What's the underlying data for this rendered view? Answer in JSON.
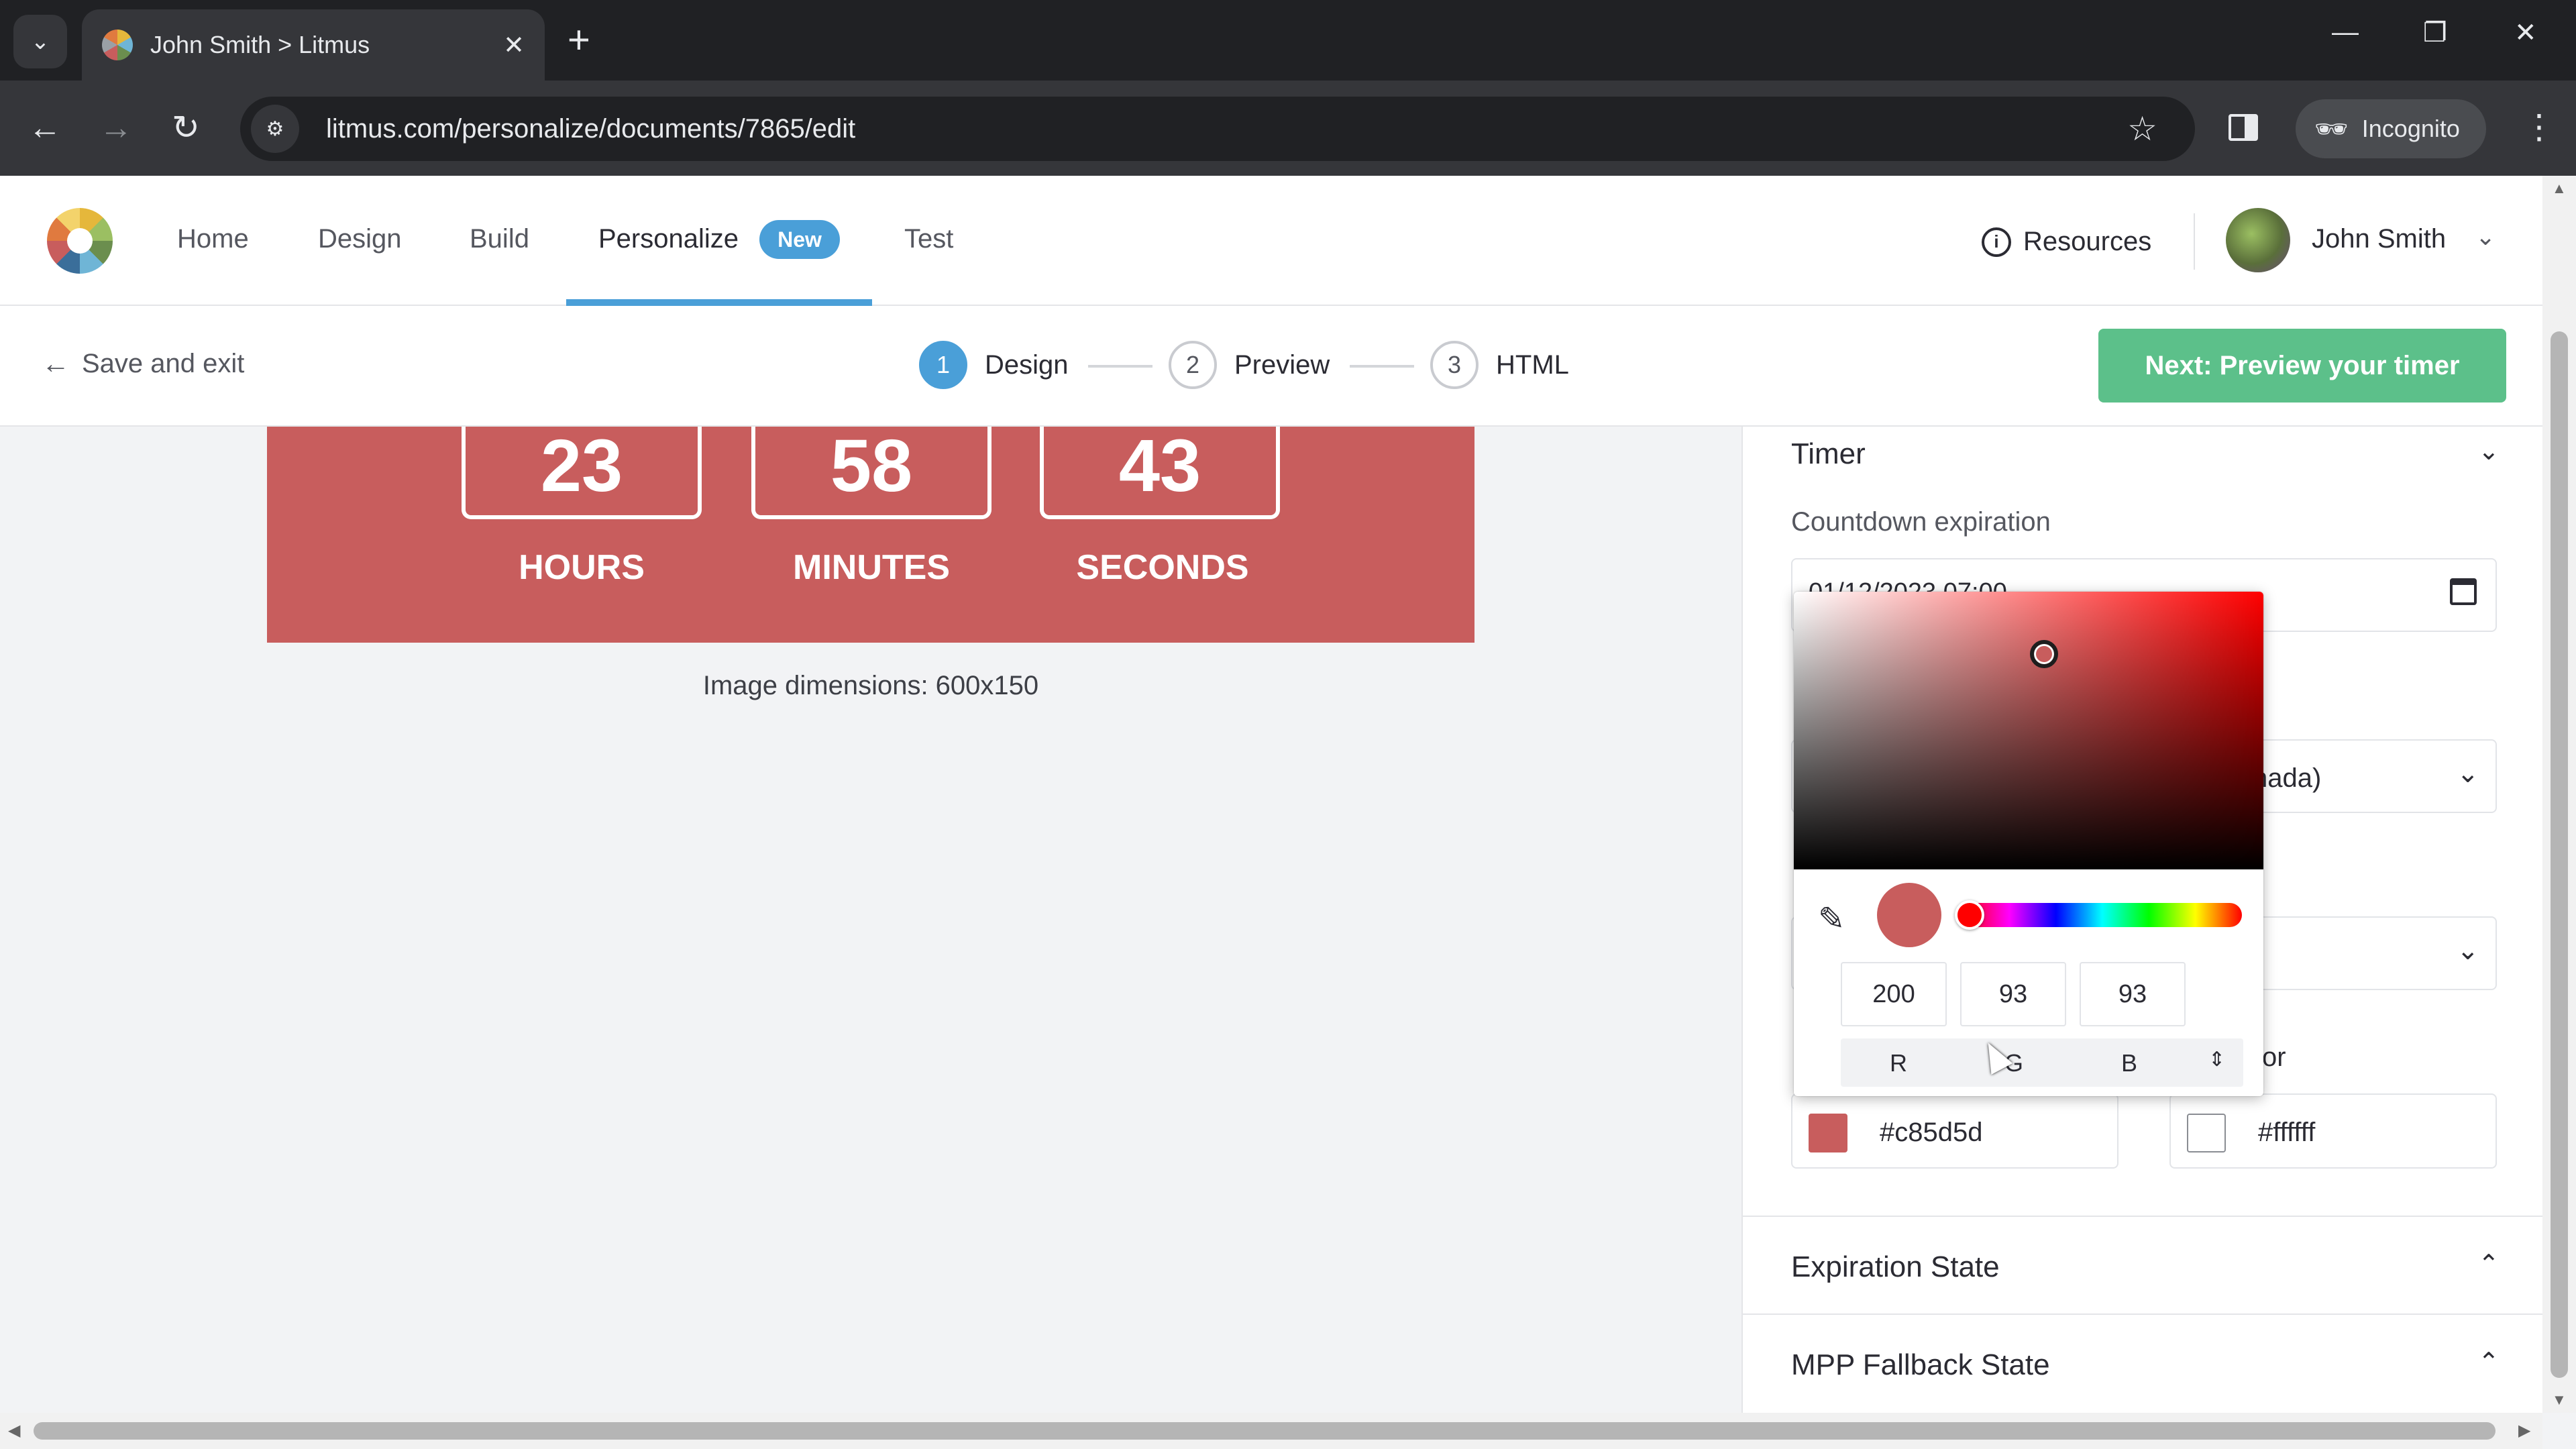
{
  "browser": {
    "tab_title": "John Smith > Litmus",
    "url": "litmus.com/personalize/documents/7865/edit",
    "incognito_label": "Incognito"
  },
  "app": {
    "nav": [
      "Home",
      "Design",
      "Build",
      "Personalize",
      "Test"
    ],
    "new_badge": "New",
    "resources": "Resources",
    "user_name": "John Smith"
  },
  "stepper": {
    "save_exit": "Save and exit",
    "steps": [
      {
        "num": "1",
        "label": "Design"
      },
      {
        "num": "2",
        "label": "Preview"
      },
      {
        "num": "3",
        "label": "HTML"
      }
    ],
    "next_button": "Next: Preview your timer"
  },
  "timer_preview": {
    "hours": "23",
    "minutes": "58",
    "seconds": "43",
    "hours_label": "HOURS",
    "minutes_label": "MINUTES",
    "seconds_label": "SECONDS",
    "background_color": "#c85d5d",
    "image_dimensions": "Image dimensions: 600x150"
  },
  "panel": {
    "timer_title": "Timer",
    "countdown_label": "Countdown expiration",
    "countdown_value_obscured": "01/12/2023 07:00",
    "timezone_partial": "nada)",
    "color_label_partial": "or",
    "bg_color_hex": "#c85d5d",
    "text_color_hex": "#ffffff",
    "expiration_state": "Expiration State",
    "mpp_fallback_state": "MPP Fallback State"
  },
  "color_picker": {
    "r": "200",
    "g": "93",
    "b": "93",
    "r_label": "R",
    "g_label": "G",
    "b_label": "B",
    "current_color": "#c85d5d",
    "hue": "#ff0000"
  }
}
